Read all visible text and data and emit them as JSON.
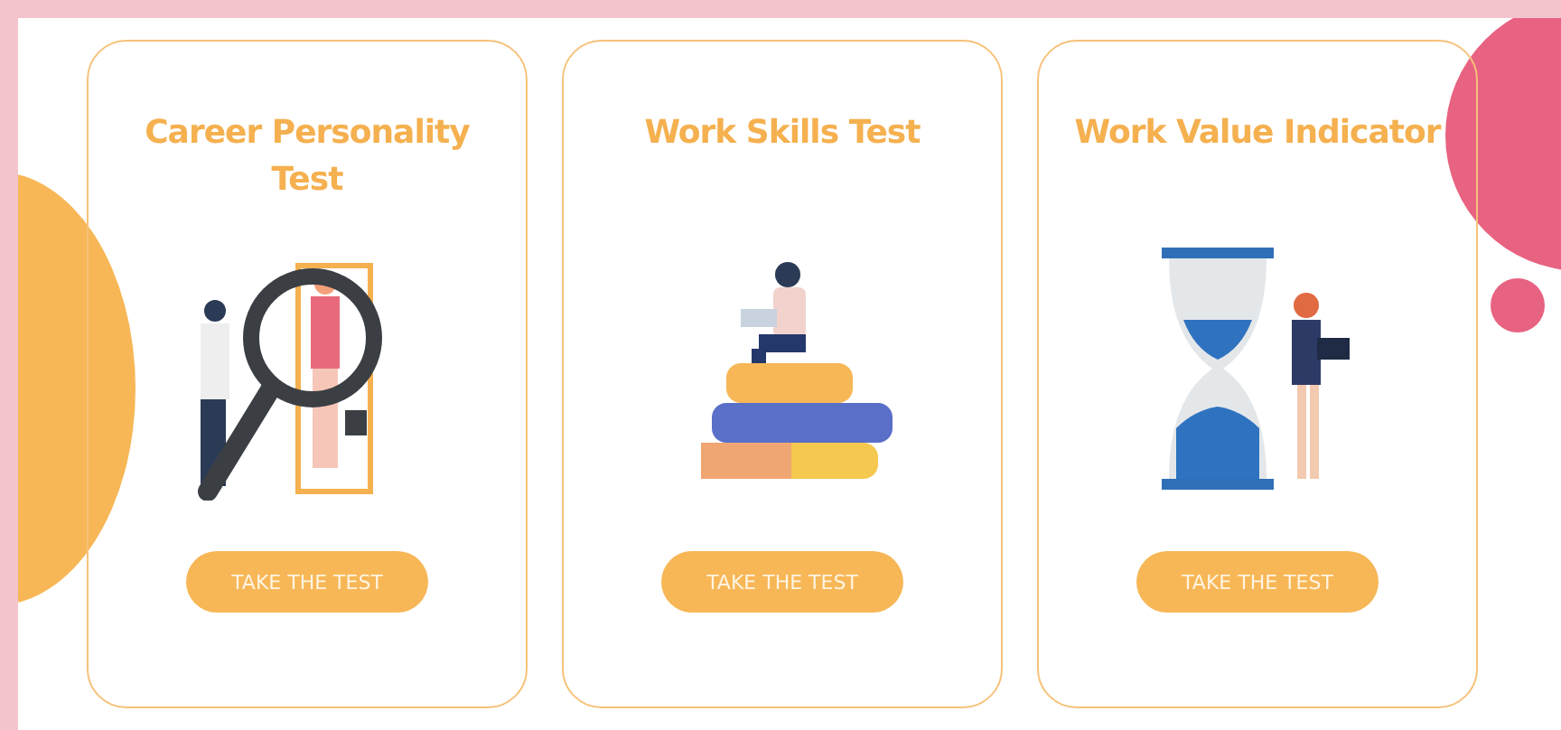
{
  "cards": [
    {
      "title": "Career Personality Test",
      "kind": "magnifier",
      "button": "TAKE THE TEST"
    },
    {
      "title": "Work Skills Test",
      "kind": "books",
      "button": "TAKE THE TEST"
    },
    {
      "title": "Work Value Indicator",
      "kind": "hourglass",
      "button": "TAKE THE TEST"
    }
  ]
}
